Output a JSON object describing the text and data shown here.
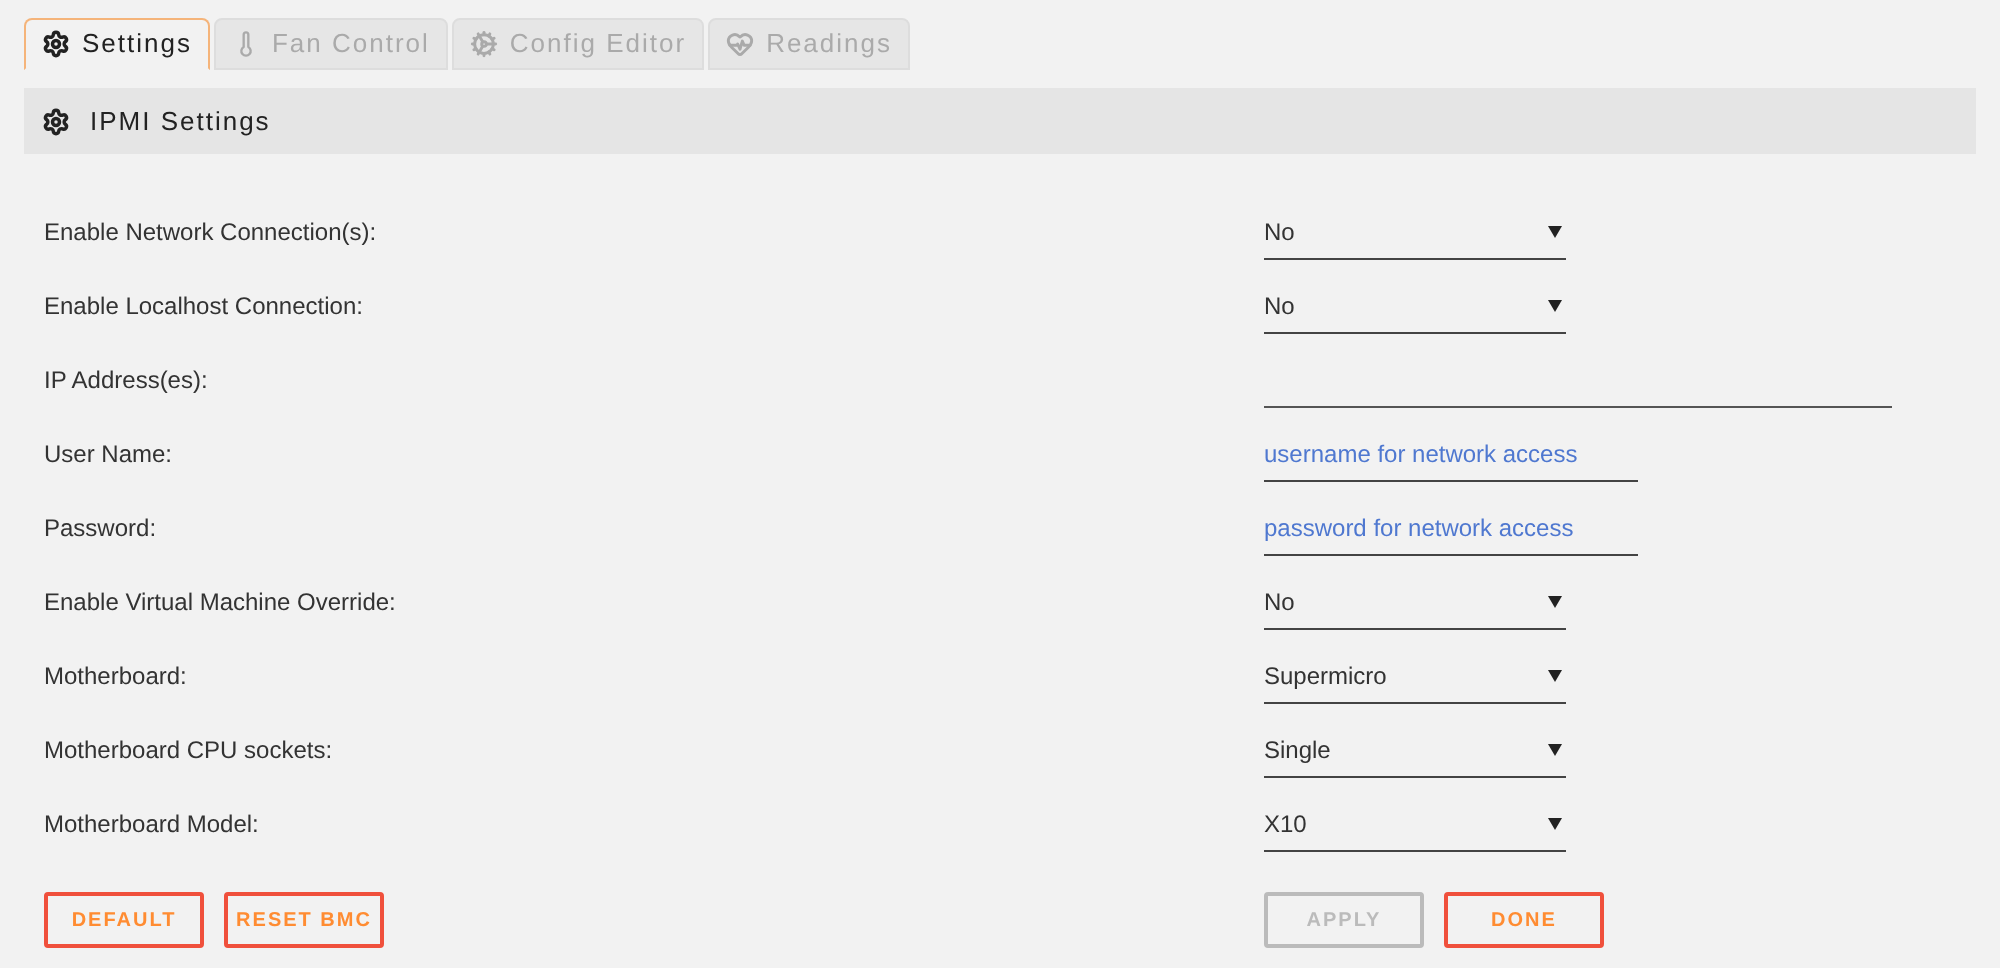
{
  "tabs": [
    {
      "label": "Settings",
      "kind": "gear",
      "selected": true
    },
    {
      "label": "Fan Control",
      "kind": "thermometer",
      "selected": false
    },
    {
      "label": "Config Editor",
      "kind": "gears",
      "selected": false
    },
    {
      "label": "Readings",
      "kind": "heart",
      "selected": false
    }
  ],
  "section": {
    "title": "IPMI Settings"
  },
  "rows": [
    {
      "label": "Enable Network Connection(s):",
      "kind": "select",
      "value": "No"
    },
    {
      "label": "Enable Localhost Connection:",
      "kind": "select",
      "value": "No"
    },
    {
      "label": "IP Address(es):",
      "kind": "wide_text"
    },
    {
      "label": "User Name:",
      "kind": "text",
      "placeholder": "username for network access"
    },
    {
      "label": "Password:",
      "kind": "text",
      "placeholder": "password for network access"
    },
    {
      "label": "Enable Virtual Machine Override:",
      "kind": "select",
      "value": "No"
    },
    {
      "label": "Motherboard:",
      "kind": "select",
      "value": "Supermicro"
    },
    {
      "label": "Motherboard CPU sockets:",
      "kind": "select",
      "value": "Single"
    },
    {
      "label": "Motherboard Model:",
      "kind": "select",
      "value": "X10"
    }
  ],
  "left_buttons": [
    {
      "label": "DEFAULT",
      "disabled": false
    },
    {
      "label": "RESET BMC",
      "disabled": false
    }
  ],
  "right_buttons": [
    {
      "label": "APPLY",
      "disabled": true
    },
    {
      "label": "DONE",
      "disabled": false
    }
  ]
}
